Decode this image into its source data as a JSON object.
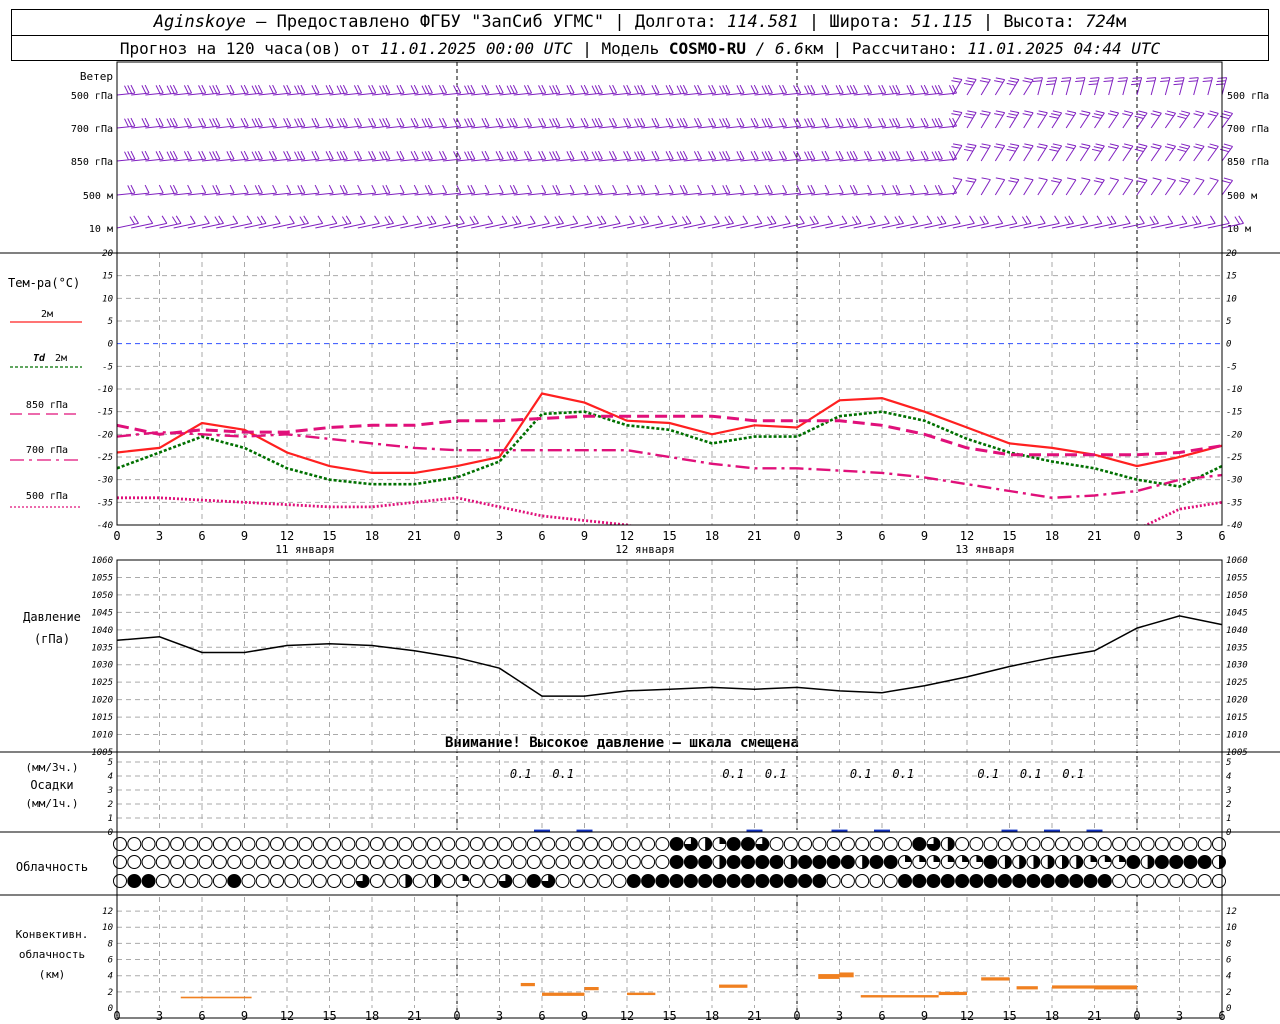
{
  "header": {
    "station": "Aginskoye",
    "provider": " – Предоставлено ФГБУ \"ЗапСиб УГМС\" | Долгота: ",
    "lon": "114.581",
    "lat_label": " | Широта: ",
    "lat": "51.115",
    "alt_label": " | Высота: ",
    "alt": "724",
    "alt_unit": "м",
    "forecast_label": "Прогноз на 120 часа(ов) от ",
    "forecast_start": "11.01.2025 00:00 UTC",
    "model_label": " | Модель ",
    "model": "COSMO-RU",
    "res": " / 6.6",
    "res_unit": "км",
    "calc_label": " | Рассчитано: ",
    "calc_time": "11.01.2025 04:44 UTC"
  },
  "wind_panel": {
    "title": "Ветер",
    "levels": [
      "500 гПа",
      "700 гПа",
      "850 гПа",
      "500 м",
      "10  м"
    ],
    "colors": {
      "barb": "#8020c0"
    }
  },
  "temp_panel": {
    "title": "Тем-ра(°C)",
    "legend": [
      {
        "label": "2м",
        "color": "#ff2020",
        "style": "solid"
      },
      {
        "label_prefix": "Td",
        "label": "2м",
        "color": "#007000",
        "style": "dotted"
      },
      {
        "label": "850 гПа",
        "color": "#e0107a",
        "style": "dashed"
      },
      {
        "label": "700 гПа",
        "color": "#e0107a",
        "style": "dashdot"
      },
      {
        "label": "500 гПа",
        "color": "#e0107a",
        "style": "dotted-fine"
      }
    ],
    "ytick_labels": [
      "20",
      "15",
      "10",
      "5",
      "0",
      "-5",
      "-10",
      "-15",
      "-20",
      "-25",
      "-30",
      "-35",
      "-40"
    ],
    "x_tick_labels": [
      "0",
      "3",
      "6",
      "9",
      "12",
      "15",
      "18",
      "21",
      "0",
      "3",
      "6",
      "9",
      "12",
      "15",
      "18",
      "21",
      "0",
      "3",
      "6",
      "9",
      "12",
      "15",
      "18",
      "21",
      "0",
      "3",
      "6"
    ],
    "day_labels": [
      "11 января",
      "12 января",
      "13 января"
    ]
  },
  "pressure_panel": {
    "title1": "Давление",
    "title2": "(гПа)",
    "ytick_labels": [
      "1060",
      "1055",
      "1050",
      "1045",
      "1040",
      "1035",
      "1030",
      "1025",
      "1020",
      "1015",
      "1010",
      "1005"
    ],
    "warning": "Внимание! Высокое давление – шкала смещена"
  },
  "precip_panel": {
    "title1": "(мм/3ч.)",
    "title2": "Осадки",
    "title3": "(мм/1ч.)",
    "ytick_labels": [
      "5",
      "4",
      "3",
      "2",
      "1",
      "0"
    ],
    "value_labels": [
      "0.1",
      "0.1",
      "0.1",
      "0.1",
      "0.1",
      "0.1",
      "0.1",
      "0.1",
      "0.1"
    ]
  },
  "cloud_panel": {
    "title": "Облачность"
  },
  "conv_panel": {
    "title1": "Конвективн.",
    "title2": "облачность",
    "title3": "(км)",
    "ytick_labels": [
      "12",
      "10",
      "8",
      "6",
      "4",
      "2",
      "0"
    ]
  },
  "chart_data": [
    {
      "type": "line",
      "title": "Тем-ра(°C)",
      "x_hours": [
        0,
        3,
        6,
        9,
        12,
        15,
        18,
        21,
        24,
        27,
        30,
        33,
        36,
        39,
        42,
        45,
        48,
        51,
        54,
        57,
        60,
        63,
        66,
        69,
        72,
        75,
        78
      ],
      "ylim": [
        -40,
        20
      ],
      "series": [
        {
          "name": "2м",
          "values": [
            -24,
            -23,
            -17.5,
            -19,
            -24,
            -27,
            -28.5,
            -28.5,
            -27,
            -25,
            -11,
            -13,
            -17,
            -17.5,
            -20,
            -18,
            -18.5,
            -12.5,
            -12,
            -15,
            -18.5,
            -22,
            -23,
            -24.5,
            -27,
            -25,
            -22.5
          ]
        },
        {
          "name": "Td 2м",
          "values": [
            -27.5,
            -24,
            -20.5,
            -23,
            -27.5,
            -30,
            -31,
            -31,
            -29.5,
            -26,
            -15.5,
            -15,
            -18,
            -19,
            -22,
            -20.5,
            -20.5,
            -16,
            -15,
            -17,
            -21,
            -24,
            -26,
            -27.5,
            -30,
            -31.5,
            -27
          ]
        },
        {
          "name": "850 гПа",
          "values": [
            -18,
            -20,
            -19,
            -19.5,
            -19.5,
            -18.5,
            -18,
            -18,
            -17,
            -17,
            -16.5,
            -16,
            -16,
            -16,
            -16,
            -17,
            -17,
            -17,
            -18,
            -20,
            -23,
            -24.5,
            -24.5,
            -24.5,
            -24.5,
            -24,
            -22.5
          ]
        },
        {
          "name": "700 гПа",
          "values": [
            -20.5,
            -19.5,
            -20,
            -20.5,
            -20,
            -21,
            -22,
            -23,
            -23.5,
            -23.5,
            -23.5,
            -23.5,
            -23.5,
            -25,
            -26.5,
            -27.5,
            -27.5,
            -28,
            -28.5,
            -29.5,
            -31,
            -32.5,
            -34,
            -33.5,
            -32.5,
            -30,
            -29
          ]
        },
        {
          "name": "500 гПа",
          "values": [
            -34,
            -34,
            -34.5,
            -35,
            -35.5,
            -36,
            -36,
            -35,
            -34,
            -36,
            -38,
            -39,
            -40,
            -43,
            -45,
            -46,
            -46,
            -45,
            -44.5,
            -44,
            -44,
            -44,
            -44,
            -43,
            -41,
            -36.5,
            -35
          ]
        }
      ]
    },
    {
      "type": "line",
      "title": "Давление",
      "x_hours": [
        0,
        3,
        6,
        9,
        12,
        15,
        18,
        21,
        24,
        27,
        30,
        33,
        36,
        39,
        42,
        45,
        48,
        51,
        54,
        57,
        60,
        63,
        66,
        69,
        72,
        75,
        78
      ],
      "ylim": [
        1005,
        1060
      ],
      "series": [
        {
          "name": "Давление",
          "values": [
            1037,
            1038,
            1033.5,
            1033.5,
            1035.5,
            1036,
            1035.5,
            1034,
            1032,
            1029,
            1021,
            1021,
            1022.5,
            1023,
            1023.5,
            1023,
            1023.5,
            1022.5,
            1022,
            1024,
            1026.5,
            1029.5,
            1032,
            1034,
            1040.5,
            1044,
            1041.5
          ]
        }
      ]
    },
    {
      "type": "bar",
      "title": "Осадки",
      "ylim": [
        0,
        5
      ],
      "x_hours": [
        30,
        33,
        45,
        51,
        54,
        63,
        66,
        69
      ],
      "values": [
        0.1,
        0.1,
        0.1,
        0.1,
        0.1,
        0.1,
        0.1,
        0.1
      ]
    },
    {
      "type": "bar",
      "title": "Конвективн. облачность (км)",
      "ylim": [
        0,
        13
      ],
      "segments": [
        {
          "x0": 4.5,
          "x1": 9.5,
          "bottom": 1.2,
          "top": 1.4
        },
        {
          "x0": 28.5,
          "x1": 29.5,
          "bottom": 2.7,
          "top": 3.1
        },
        {
          "x0": 30,
          "x1": 33,
          "bottom": 1.5,
          "top": 1.9
        },
        {
          "x0": 33,
          "x1": 34,
          "bottom": 2.2,
          "top": 2.6
        },
        {
          "x0": 36,
          "x1": 38,
          "bottom": 1.6,
          "top": 1.9
        },
        {
          "x0": 42.5,
          "x1": 44.5,
          "bottom": 2.5,
          "top": 2.9
        },
        {
          "x0": 49.5,
          "x1": 51,
          "bottom": 3.6,
          "top": 4.2
        },
        {
          "x0": 51,
          "x1": 52,
          "bottom": 3.8,
          "top": 4.4
        },
        {
          "x0": 52.5,
          "x1": 58,
          "bottom": 1.3,
          "top": 1.6
        },
        {
          "x0": 58,
          "x1": 60,
          "bottom": 1.6,
          "top": 2.0
        },
        {
          "x0": 61,
          "x1": 63,
          "bottom": 3.4,
          "top": 3.8
        },
        {
          "x0": 63.5,
          "x1": 65,
          "bottom": 2.3,
          "top": 2.7
        },
        {
          "x0": 66,
          "x1": 69,
          "bottom": 2.4,
          "top": 2.8
        },
        {
          "x0": 69,
          "x1": 72,
          "bottom": 2.3,
          "top": 2.8
        }
      ]
    },
    {
      "type": "heatmap",
      "title": "Облачность",
      "rows": 3,
      "cells_per_row": 78
    }
  ]
}
